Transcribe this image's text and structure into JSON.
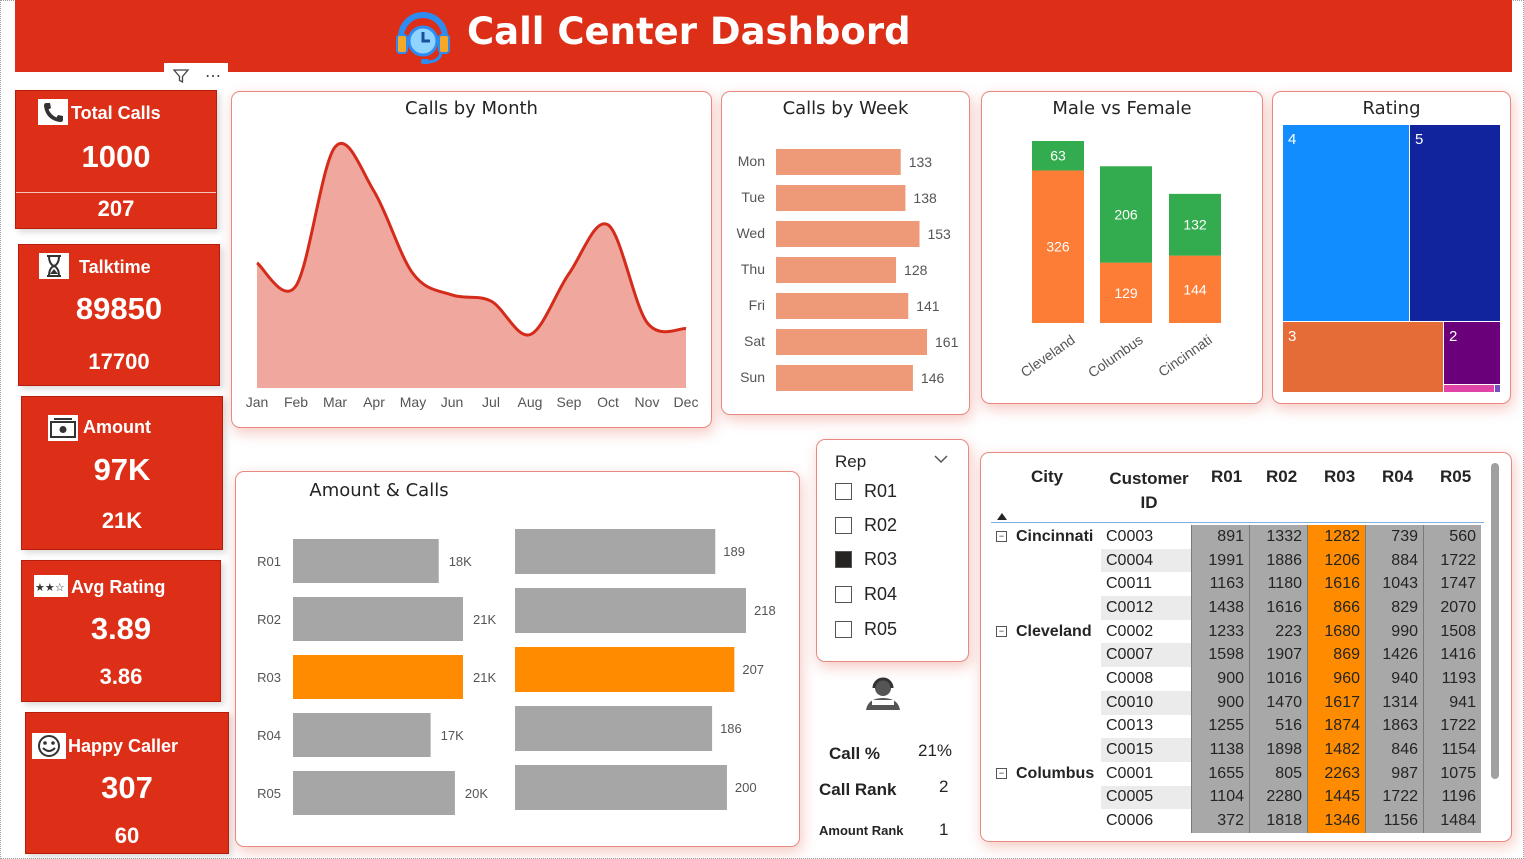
{
  "header": {
    "title": "Call Center Dashbord"
  },
  "kpis": [
    {
      "label": "Total Calls",
      "value": "1000",
      "sub": "207",
      "icon": "phone-icon"
    },
    {
      "label": "Talktime",
      "value": "89850",
      "sub": "17700",
      "icon": "hourglass-icon"
    },
    {
      "label": "Amount",
      "value": "97K",
      "sub": "21K",
      "icon": "money-icon"
    },
    {
      "label": "Avg Rating",
      "value": "3.89",
      "sub": "3.86",
      "icon": "stars-icon"
    },
    {
      "label": "Happy Caller",
      "value": "307",
      "sub": "60",
      "icon": "smiley-icon"
    }
  ],
  "calls_by_month": {
    "title": "Calls by Month",
    "categories": [
      "Jan",
      "Feb",
      "Mar",
      "Apr",
      "May",
      "Jun",
      "Jul",
      "Aug",
      "Sep",
      "Oct",
      "Nov",
      "Dec"
    ],
    "values": [
      82,
      67,
      158,
      129,
      75,
      61,
      57,
      35,
      75,
      107,
      43,
      39
    ]
  },
  "calls_by_week": {
    "title": "Calls by Week",
    "categories": [
      "Mon",
      "Tue",
      "Wed",
      "Thu",
      "Fri",
      "Sat",
      "Sun"
    ],
    "values": [
      133,
      138,
      153,
      128,
      141,
      161,
      146
    ]
  },
  "male_female": {
    "title": "Male vs Female",
    "categories": [
      "Cleveland",
      "Columbus",
      "Cincinnati"
    ],
    "series": [
      {
        "values": [
          326,
          129,
          144
        ],
        "color": "#fd7c36"
      },
      {
        "values": [
          63,
          206,
          132
        ],
        "color": "#32ac4e"
      }
    ]
  },
  "rating": {
    "title": "Rating",
    "tiles": [
      {
        "label": "4",
        "color": "#118dff"
      },
      {
        "label": "5",
        "color": "#12239e"
      },
      {
        "label": "3",
        "color": "#e66c37"
      },
      {
        "label": "2",
        "color": "#6b007b"
      },
      {
        "label": "",
        "color": "#e044a7"
      },
      {
        "label": "",
        "color": "#744ec2"
      }
    ]
  },
  "amount_calls": {
    "title": "Amount & Calls",
    "categories": [
      "R01",
      "R02",
      "R03",
      "R04",
      "R05"
    ],
    "amount_values": [
      18,
      21,
      21,
      17,
      20
    ],
    "amount_labels": [
      "18K",
      "21K",
      "21K",
      "17K",
      "20K"
    ],
    "call_values": [
      189,
      218,
      207,
      186,
      200
    ],
    "highlight": "R03",
    "bar_color": "#a6a6a6",
    "highlight_color": "#ff8c00"
  },
  "slicer": {
    "title": "Rep",
    "options": [
      {
        "label": "R01",
        "checked": false
      },
      {
        "label": "R02",
        "checked": false
      },
      {
        "label": "R03",
        "checked": true
      },
      {
        "label": "R04",
        "checked": false
      },
      {
        "label": "R05",
        "checked": false
      }
    ]
  },
  "rep_stats": [
    {
      "label": "Call %",
      "value": "21%"
    },
    {
      "label": "Call Rank",
      "value": "2"
    },
    {
      "label": "Amount Rank",
      "value": "1"
    }
  ],
  "matrix": {
    "headers": [
      "City",
      "Customer ID",
      "R01",
      "R02",
      "R03",
      "R04",
      "R05"
    ],
    "groups": [
      {
        "city": "Cincinnati",
        "rows": [
          {
            "id": "C0003",
            "v": [
              "891",
              "1332",
              "1282",
              "739",
              "560"
            ]
          },
          {
            "id": "C0004",
            "v": [
              "1991",
              "1886",
              "1206",
              "884",
              "1722"
            ]
          },
          {
            "id": "C0011",
            "v": [
              "1163",
              "1180",
              "1616",
              "1043",
              "1747"
            ]
          },
          {
            "id": "C0012",
            "v": [
              "1438",
              "1616",
              "866",
              "829",
              "2070"
            ]
          }
        ]
      },
      {
        "city": "Cleveland",
        "rows": [
          {
            "id": "C0002",
            "v": [
              "1233",
              "223",
              "1680",
              "990",
              "1508"
            ]
          },
          {
            "id": "C0007",
            "v": [
              "1598",
              "1907",
              "869",
              "1426",
              "1416"
            ]
          },
          {
            "id": "C0008",
            "v": [
              "900",
              "1016",
              "960",
              "940",
              "1193"
            ]
          },
          {
            "id": "C0010",
            "v": [
              "900",
              "1470",
              "1617",
              "1314",
              "941"
            ]
          },
          {
            "id": "C0013",
            "v": [
              "1255",
              "516",
              "1874",
              "1863",
              "1722"
            ]
          },
          {
            "id": "C0015",
            "v": [
              "1138",
              "1898",
              "1482",
              "846",
              "1154"
            ]
          }
        ]
      },
      {
        "city": "Columbus",
        "rows": [
          {
            "id": "C0001",
            "v": [
              "1655",
              "805",
              "2263",
              "987",
              "1075"
            ]
          },
          {
            "id": "C0005",
            "v": [
              "1104",
              "2280",
              "1445",
              "1722",
              "1196"
            ]
          },
          {
            "id": "C0006",
            "v": [
              "372",
              "1818",
              "1346",
              "1156",
              "1484"
            ]
          }
        ]
      }
    ]
  },
  "colors": {
    "brand": "#dd2f17",
    "area": "#f0a89e",
    "week_bar": "#ee9a79"
  }
}
